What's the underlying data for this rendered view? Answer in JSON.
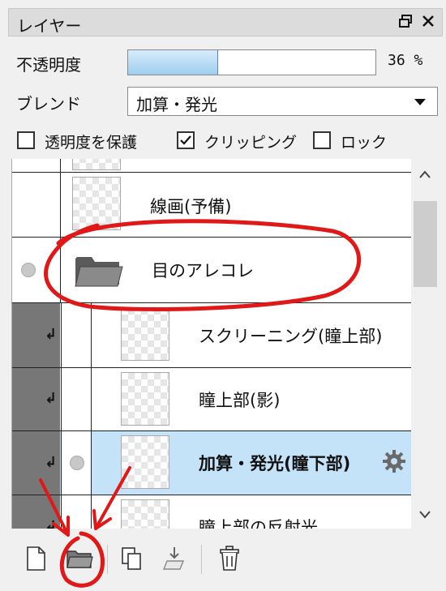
{
  "panel": {
    "title": "レイヤー"
  },
  "opacity": {
    "label": "不透明度",
    "value_text": "36 %",
    "value": 36
  },
  "blend": {
    "label": "ブレンド",
    "selected": "加算・発光"
  },
  "checkboxes": [
    {
      "label": "透明度を保護",
      "checked": false
    },
    {
      "label": "クリッピング",
      "checked": true
    },
    {
      "label": "ロック",
      "checked": false
    }
  ],
  "layers": [
    {
      "name": "",
      "type": "layer"
    },
    {
      "name": "線画(予備)",
      "type": "layer"
    },
    {
      "name": "目のアレコレ",
      "type": "folder"
    },
    {
      "name": "スクリーニング(瞳上部)",
      "type": "layer",
      "clipped": true
    },
    {
      "name": "瞳上部(影)",
      "type": "layer",
      "clipped": true
    },
    {
      "name": "加算・発光(瞳下部)",
      "type": "layer",
      "clipped": true,
      "selected": true
    },
    {
      "name": "瞳上部の反射光",
      "type": "layer",
      "clipped": true
    }
  ],
  "colors": {
    "selected_row": "#c5e3f8",
    "annotation": "#e01818",
    "clip_strip": "#777777"
  },
  "toolbar": {
    "icons": [
      "new-layer-icon",
      "new-folder-icon",
      "copy-layer-icon",
      "merge-down-icon",
      "trash-icon"
    ]
  }
}
